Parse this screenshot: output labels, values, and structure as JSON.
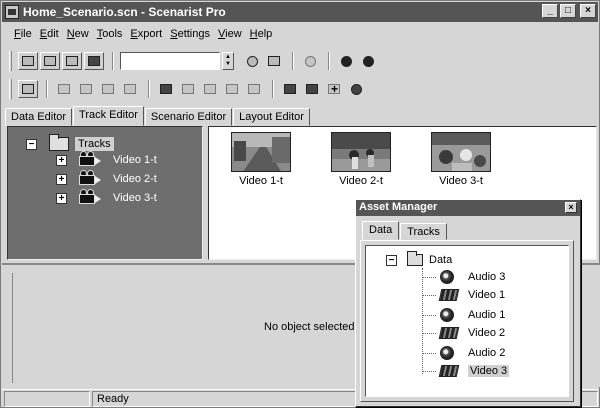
{
  "window": {
    "title": "Home_Scenario.scn - Scenarist Pro",
    "controls": [
      "_",
      "□",
      "×"
    ]
  },
  "menu": [
    "File",
    "Edit",
    "New",
    "Tools",
    "Export",
    "Settings",
    "View",
    "Help"
  ],
  "tabs": [
    "Data Editor",
    "Track Editor",
    "Scenario Editor",
    "Layout Editor"
  ],
  "active_tab": "Track Editor",
  "track_tree": {
    "root": "Tracks",
    "items": [
      "Video 1-t",
      "Video 2-t",
      "Video 3-t"
    ]
  },
  "thumbnails": [
    {
      "label": "Video 1-t"
    },
    {
      "label": "Video 2-t"
    },
    {
      "label": "Video 3-t"
    }
  ],
  "properties_panel": {
    "empty_text": "No object selected"
  },
  "status": {
    "text": "Ready"
  },
  "asset_manager": {
    "title": "Asset Manager",
    "close": "×",
    "tabs": [
      "Data",
      "Tracks"
    ],
    "active_tab": "Data",
    "root": "Data",
    "items": [
      {
        "label": "Audio 3",
        "type": "audio"
      },
      {
        "label": "Video 1",
        "type": "video"
      },
      {
        "label": "Audio 1",
        "type": "audio"
      },
      {
        "label": "Video 2",
        "type": "video"
      },
      {
        "label": "Audio 2",
        "type": "audio"
      },
      {
        "label": "Video 3",
        "type": "video",
        "selected": true
      }
    ]
  },
  "icons": {
    "toolbar_row1": [
      "view-single-icon",
      "view-dual-icon",
      "view-split-icon",
      "view-timeline-icon",
      "zoom-combo",
      "spinner",
      "refresh-icon",
      "properties-icon",
      "disabled-icon",
      "zoom-in-icon",
      "zoom-out-icon"
    ],
    "toolbar_row2": [
      "open-icon",
      "add-track-icon",
      "add-track-multi-icon",
      "audio-add-icon",
      "save-icon",
      "folder-icon",
      "link-icon",
      "audio-icon",
      "film-icon",
      "list-icon",
      "palette-icon",
      "folder-open-icon",
      "cut-icon",
      "disc-icon"
    ]
  }
}
